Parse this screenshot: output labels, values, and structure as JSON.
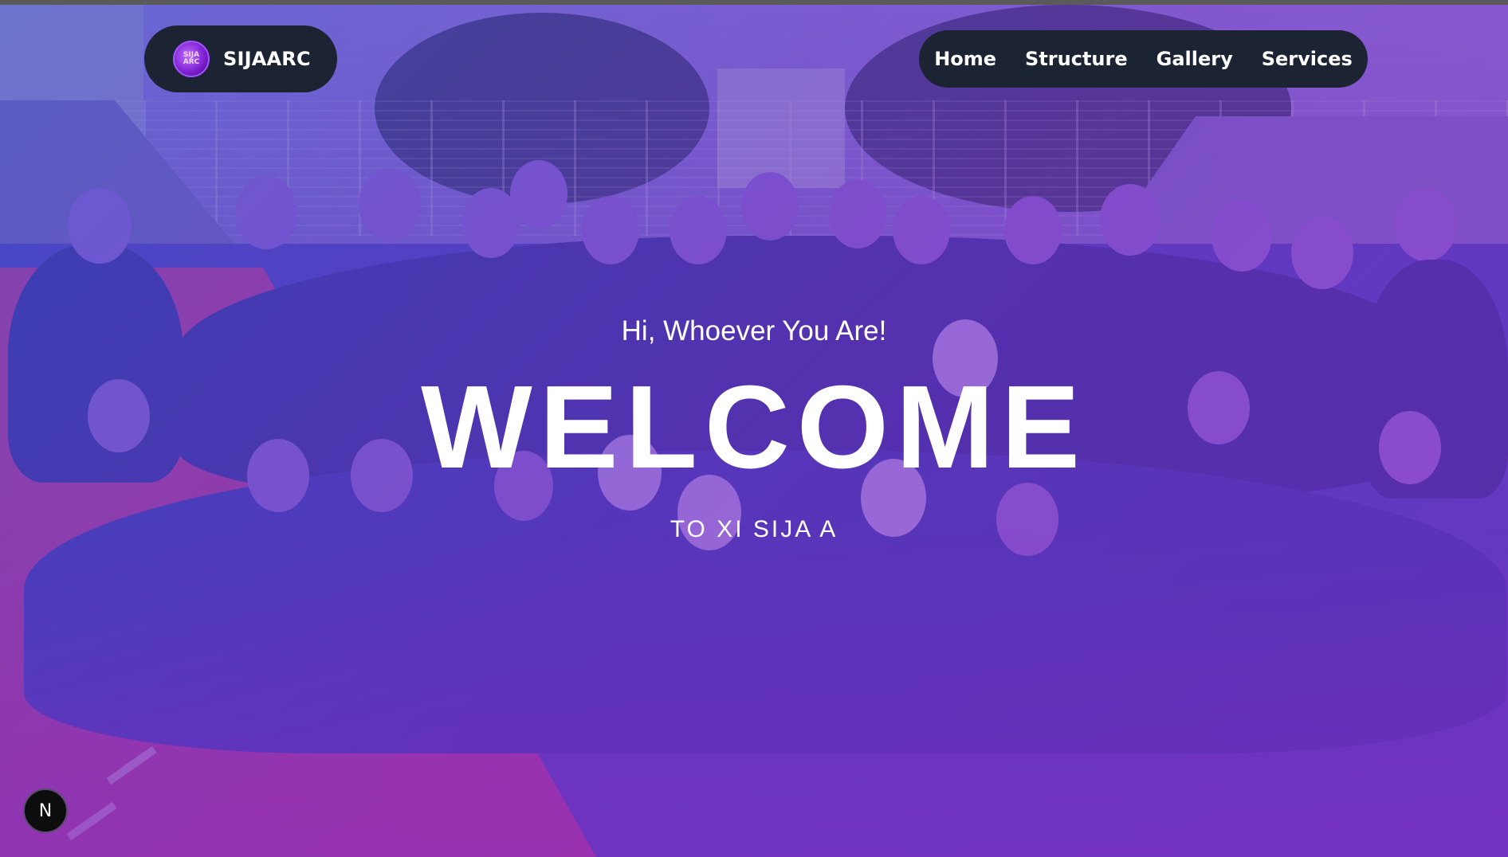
{
  "brand": {
    "logo_text": "SIJA ARC",
    "name": "SIJAARC"
  },
  "nav": {
    "items": [
      {
        "label": "Home"
      },
      {
        "label": "Structure"
      },
      {
        "label": "Gallery"
      },
      {
        "label": "Services"
      }
    ]
  },
  "hero": {
    "greeting": "Hi, Whoever You Are!",
    "headline": "WELCOME",
    "subline": "TO XI SIJA A",
    "background_image": "group-photo",
    "overlay_colors": [
      "#4650d2",
      "#7832c8",
      "#9628c8"
    ]
  },
  "dev_indicator": {
    "label": "N",
    "icon": "nextjs-icon"
  }
}
